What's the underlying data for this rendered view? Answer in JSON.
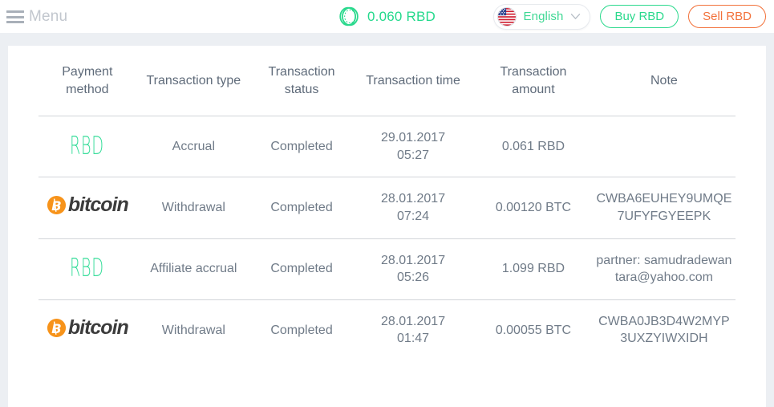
{
  "header": {
    "menu_label": "Menu",
    "menu_icon": "hamburger-icon",
    "balance_icon": "rbd-coin-icon",
    "balance_amount": "0.060 RBD",
    "language": {
      "flag_icon": "us-flag-icon",
      "label": "English",
      "chevron_icon": "chevron-down-icon"
    },
    "buy_button": "Buy RBD",
    "sell_button": "Sell RBD",
    "accent_green": "#2ad98d",
    "accent_orange": "#f2713a"
  },
  "table": {
    "columns": [
      "Payment method",
      "Transaction type",
      "Transaction status",
      "Transaction time",
      "Transaction amount",
      "Note"
    ],
    "rows": [
      {
        "payment_method": "RBD",
        "payment_method_icon": "rbd-logo",
        "transaction_type": "Accrual",
        "transaction_status": "Completed",
        "date": "29.01.2017",
        "time": "05:27",
        "amount": "0.061 RBD",
        "note": ""
      },
      {
        "payment_method": "bitcoin",
        "payment_method_icon": "bitcoin-logo",
        "transaction_type": "Withdrawal",
        "transaction_status": "Completed",
        "date": "28.01.2017",
        "time": "07:24",
        "amount": "0.00120 BTC",
        "note": "CWBA6EUHEY9UMQE7UFYFGYEEPK"
      },
      {
        "payment_method": "RBD",
        "payment_method_icon": "rbd-logo",
        "transaction_type": "Affiliate accrual",
        "transaction_status": "Completed",
        "date": "28.01.2017",
        "time": "05:26",
        "amount": "1.099 RBD",
        "note": "partner: samudradewantara@yahoo.com"
      },
      {
        "payment_method": "bitcoin",
        "payment_method_icon": "bitcoin-logo",
        "transaction_type": "Withdrawal",
        "transaction_status": "Completed",
        "date": "28.01.2017",
        "time": "01:47",
        "amount": "0.00055 BTC",
        "note": "CWBA0JB3D4W2MYP3UXZYIWXIDH"
      }
    ]
  }
}
